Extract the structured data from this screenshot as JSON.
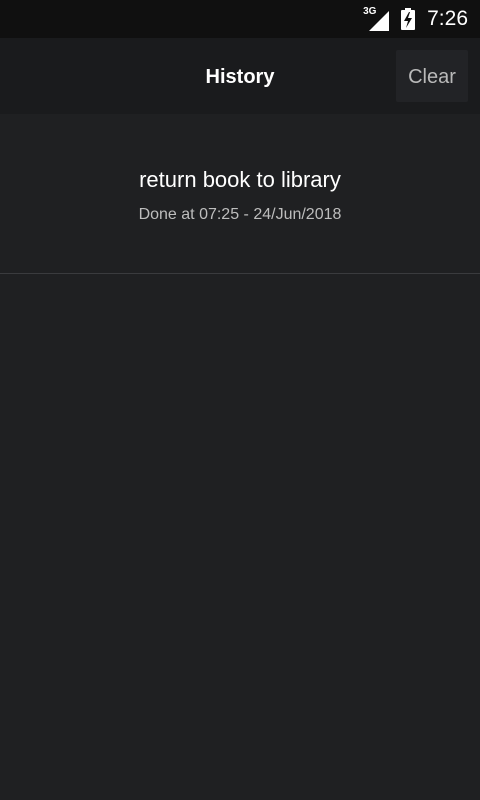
{
  "status_bar": {
    "network_type": "3G",
    "time": "7:26",
    "signal_icon": "cellular-signal-icon",
    "battery_icon": "battery-charging-icon"
  },
  "app_bar": {
    "title": "History",
    "clear_label": "Clear"
  },
  "history": {
    "items": [
      {
        "title": "return book to library",
        "subtitle": "Done at 07:25 - 24/Jun/2018"
      }
    ]
  },
  "colors": {
    "background": "#1f2022",
    "app_bar": "#1a1b1d",
    "status_bar": "#101010",
    "text_primary": "#ffffff",
    "text_secondary": "#bdbdbd"
  }
}
